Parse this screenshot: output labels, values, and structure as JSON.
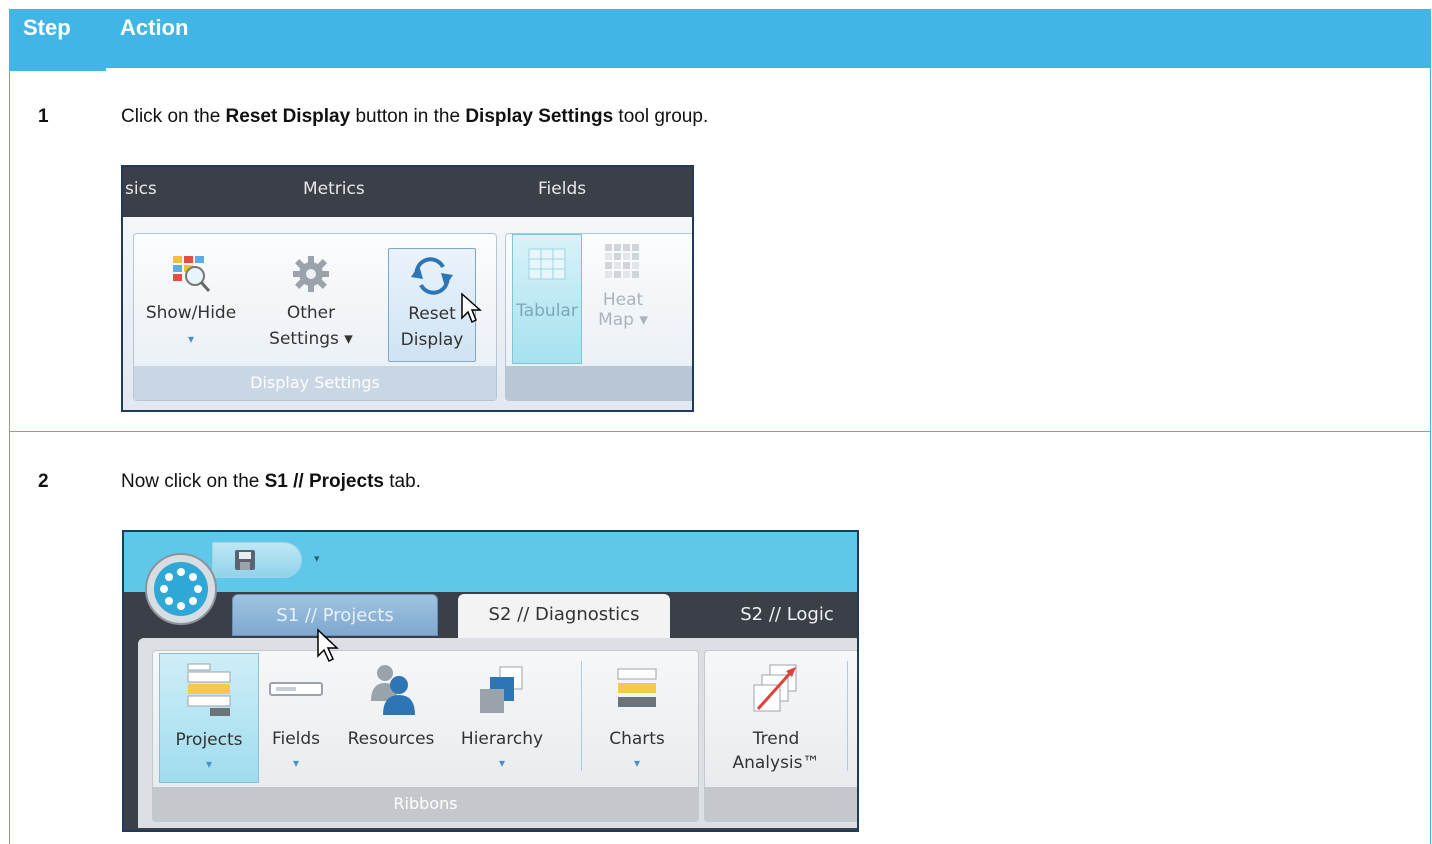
{
  "header": {
    "step_label": "Step",
    "action_label": "Action"
  },
  "steps": [
    {
      "number": "1",
      "text_parts": [
        "Click on the ",
        "Reset Display",
        " button in the ",
        "Display Settings",
        " tool group."
      ],
      "screenshot": {
        "tabs": [
          "sics",
          "Metrics",
          "Fields"
        ],
        "buttons": [
          {
            "line1": "Show/Hide",
            "line2": "▾",
            "icon": "show-hide-icon"
          },
          {
            "line1": "Other",
            "line2": "Settings ▾",
            "icon": "gear-icon"
          },
          {
            "line1": "Reset",
            "line2": "Display",
            "icon": "reset-icon"
          },
          {
            "line1": "Tabular",
            "line2": "",
            "icon": "grid-icon"
          },
          {
            "line1": "Heat",
            "line2": "Map ▾",
            "icon": "heat-map-icon"
          }
        ],
        "group_label": "Display Settings"
      }
    },
    {
      "number": "2",
      "text_parts": [
        "Now click on the ",
        "S1 // Projects",
        " tab."
      ],
      "screenshot": {
        "tabs": [
          "S1 // Projects",
          "S2 // Diagnostics",
          "S2 // Logic"
        ],
        "buttons": [
          {
            "line1": "Projects",
            "line2": "▾",
            "icon": "projects-icon"
          },
          {
            "line1": "Fields",
            "line2": "▾",
            "icon": "fields-icon"
          },
          {
            "line1": "Resources",
            "line2": "",
            "icon": "resources-icon"
          },
          {
            "line1": "Hierarchy",
            "line2": "▾",
            "icon": "hierarchy-icon"
          },
          {
            "line1": "Charts",
            "line2": "▾",
            "icon": "charts-icon"
          },
          {
            "line1": "Trend",
            "line2": "Analysis™",
            "icon": "trend-analysis-icon"
          }
        ],
        "group_label": "Ribbons"
      }
    }
  ],
  "colors": {
    "header_bg": "#41b6e6",
    "accent": "#41b6e6"
  }
}
